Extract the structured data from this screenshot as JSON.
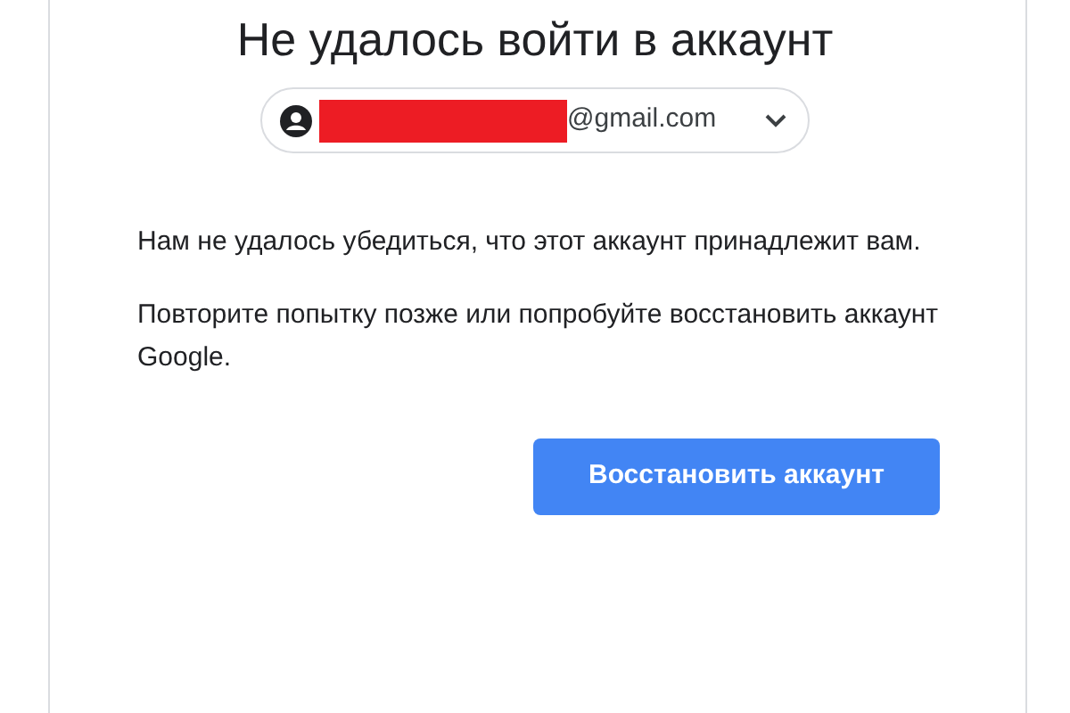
{
  "title": "Не удалось войти в аккаунт",
  "account_chip": {
    "email_visible": "@gmail.com",
    "redacted": true
  },
  "paragraphs": [
    "Нам не удалось убедиться, что этот аккаунт принадлежит вам.",
    "Повторите попытку позже или попробуйте восстановить аккаунт Google."
  ],
  "button": {
    "label": "Восстановить аккаунт"
  }
}
